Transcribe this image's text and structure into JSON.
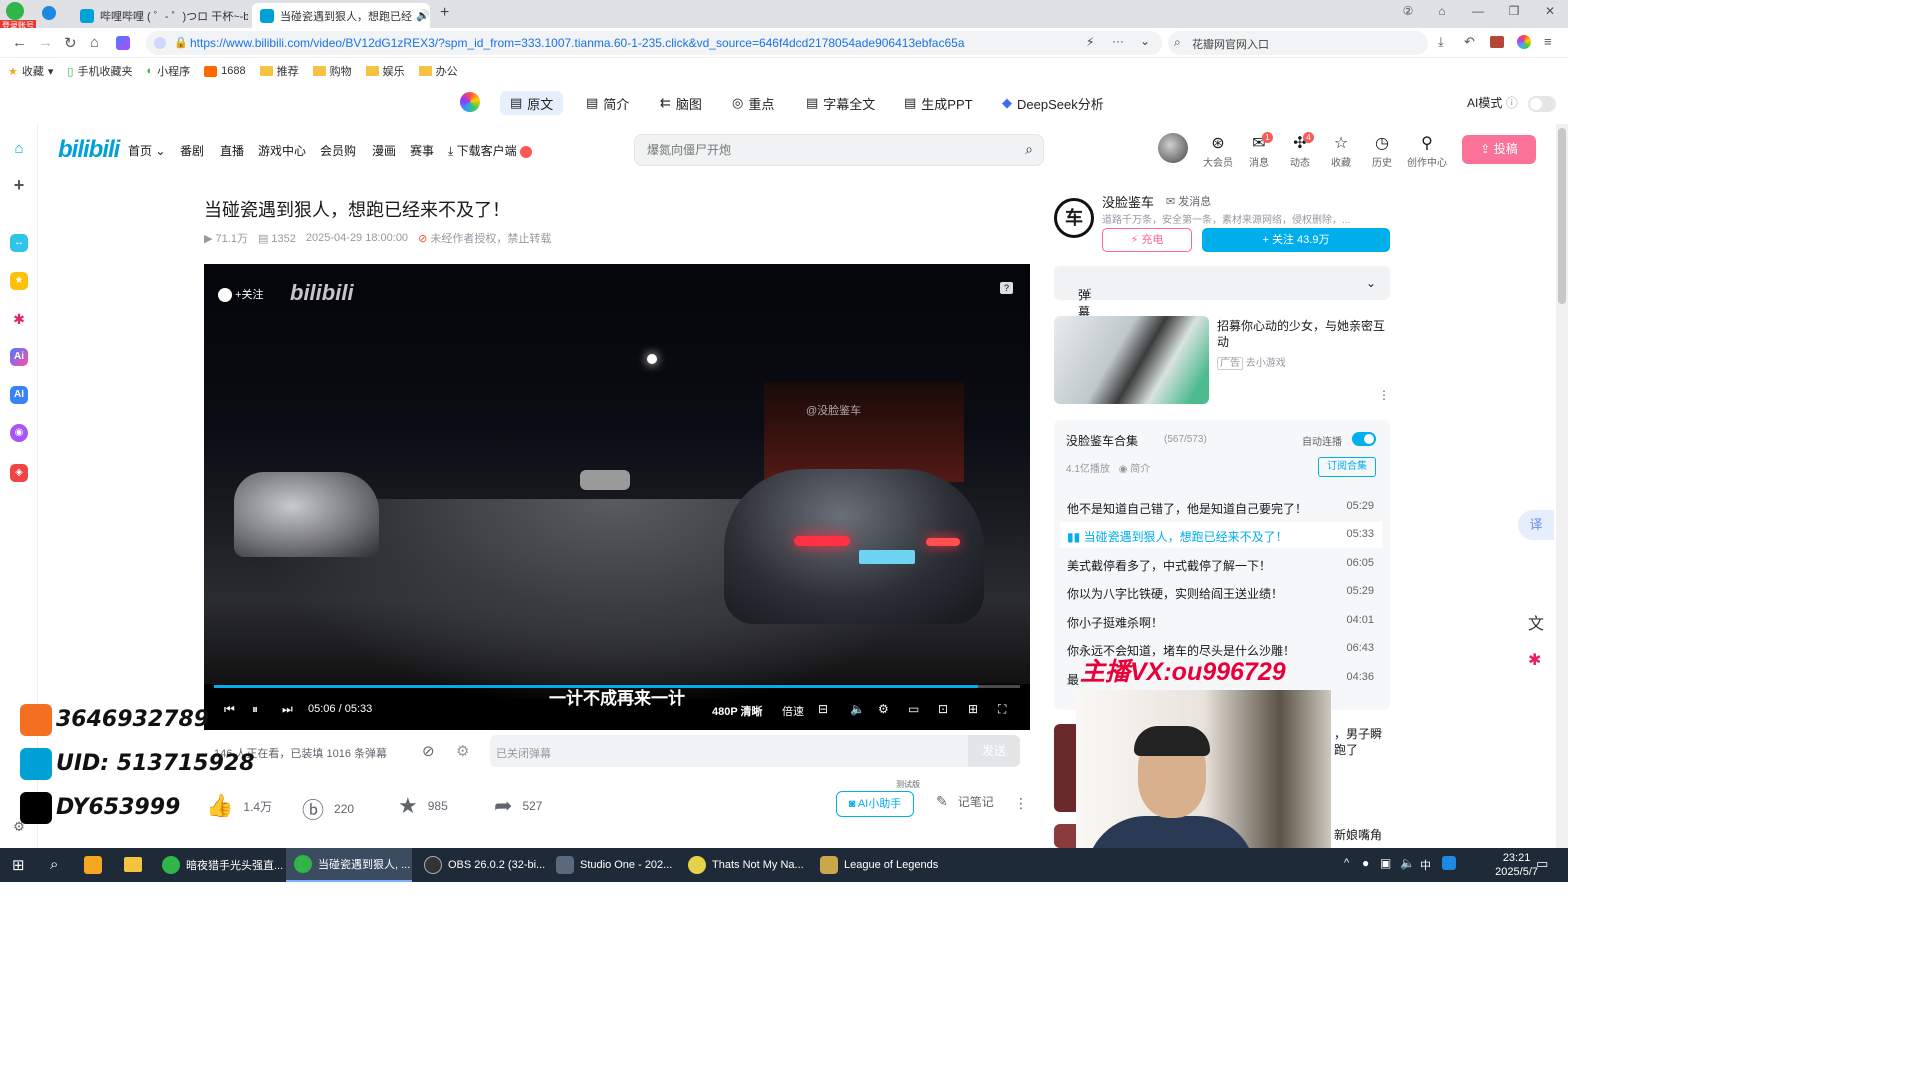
{
  "browser": {
    "corner_badge": "登录账号",
    "tabs": [
      {
        "label": "哔哩哔哩 ( ゜- ゜)つロ 干杯~-b"
      },
      {
        "label": "当碰瓷遇到狠人，想跑已经"
      }
    ],
    "url": "https://www.bilibili.com/video/BV12dG1zREX3/?spm_id_from=333.1007.tianma.60-1-235.click&vd_source=646f4dcd2178054ade906413ebfac65a",
    "search_placeholder": "花瓣网官网入口",
    "bookmarks": [
      "收藏",
      "手机收藏夹",
      "小程序",
      "1688",
      "推荐",
      "购物",
      "娱乐",
      "办公"
    ]
  },
  "ai_toolbar": {
    "buttons": [
      "原文",
      "简介",
      "脑图",
      "重点",
      "字幕全文",
      "生成PPT",
      "DeepSeek分析"
    ],
    "mode_label": "AI模式"
  },
  "bili_header": {
    "logo": "bilibili",
    "nav": [
      "首页",
      "番剧",
      "直播",
      "游戏中心",
      "会员购",
      "漫画",
      "赛事",
      "下载客户端"
    ],
    "search_placeholder": "爆氮向僵尸开炮",
    "icons": [
      {
        "label": "大会员",
        "badge": ""
      },
      {
        "label": "消息",
        "badge": "1"
      },
      {
        "label": "动态",
        "badge": "4"
      },
      {
        "label": "收藏",
        "badge": ""
      },
      {
        "label": "历史",
        "badge": ""
      },
      {
        "label": "创作中心",
        "badge": ""
      }
    ],
    "upload_label": "投稿"
  },
  "video": {
    "title": "当碰瓷遇到狠人，想跑已经来不及了！",
    "views": "71.1万",
    "danmaku": "1352",
    "date": "2025-04-29 18:00:00",
    "copyright": "未经作者授权，禁止转载",
    "watermark_logo": "bilibili",
    "watermark_follow": "+关注",
    "watermark_channel": "@没脸鉴车",
    "subtitle": "一计不成再来一计",
    "progress": 0.948,
    "time_current": "05:06",
    "time_total": "05:33",
    "quality": "480P 清晰",
    "speed": "倍速"
  },
  "danmaku_bar": {
    "viewers": "146 人正在看，已装填 1016 条弹幕",
    "input_placeholder": "已关闭弹幕",
    "send_label": "发送"
  },
  "actions": {
    "like": "1.4万",
    "coin": "220",
    "fav": "985",
    "share": "527",
    "ai_helper": "AI小助手",
    "ai_tag": "测试版",
    "notes": "记笔记"
  },
  "uploader": {
    "avatar_char": "车",
    "name": "没脸鉴车",
    "msg_label": "发消息",
    "desc": "道路千万条，安全第一条，素材来源网络，侵权删除，...",
    "charge_label": "充电",
    "follow_label": "+ 关注 43.9万"
  },
  "danmaku_list": {
    "label": "弹幕列表"
  },
  "ad": {
    "title": "招募你心动的少女，与她亲密互动",
    "tag": "广告",
    "source": "去小游戏"
  },
  "playlist": {
    "title": "没脸鉴车合集",
    "count": "(567/573)",
    "autoplay_label": "自动连播",
    "plays": "4.1亿播放",
    "intro_label": "简介",
    "subscribe_label": "订阅合集",
    "items": [
      {
        "title": "他不是知道自己错了，他是知道自己要完了！",
        "duration": "05:29"
      },
      {
        "title": "当碰瓷遇到狠人，想跑已经来不及了！",
        "duration": "05:33"
      },
      {
        "title": "美式截停看多了，中式截停了解一下！",
        "duration": "06:05"
      },
      {
        "title": "你以为八字比铁硬，实则给阎王送业绩！",
        "duration": "05:29"
      },
      {
        "title": "你小子挺难杀啊！",
        "duration": "04:01"
      },
      {
        "title": "你永远不会知道，堵车的尽头是什么沙雕！",
        "duration": "06:43"
      },
      {
        "title": "最",
        "duration": "04:36"
      }
    ],
    "below_snippet_1": "，男子瞬跑了",
    "below_snippet_2": "新娘嘴角"
  },
  "overlay": {
    "vx": "主播VX:ou996729",
    "qq": "3646932789",
    "uid": "UID: 513715928",
    "dy": "DY653999"
  },
  "taskbar": {
    "apps": [
      "暗夜猎手光头强直...",
      "当碰瓷遇到狠人, ...",
      "OBS 26.0.2 (32-bi...",
      "Studio One - 202...",
      "Thats Not My Na...",
      "League of Legends"
    ],
    "time": "23:21",
    "date": "2025/5/7",
    "ime": "中"
  }
}
